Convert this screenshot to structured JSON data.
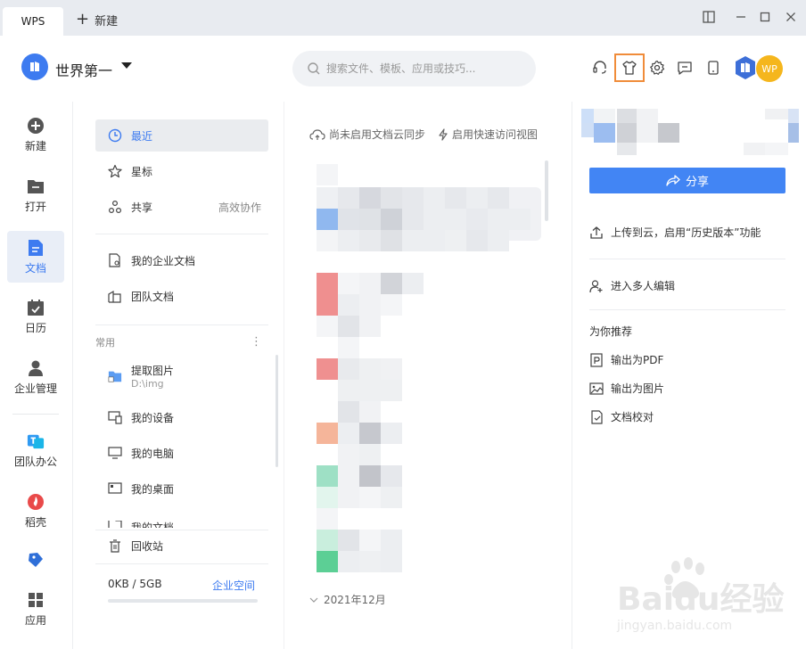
{
  "titlebar": {
    "tab_label": "WPS",
    "new_tab_label": "新建"
  },
  "header": {
    "workspace_name": "世界第一",
    "search_placeholder": "搜索文件、模板、应用或技巧...",
    "avatar_text": "WP"
  },
  "nav": {
    "items": [
      {
        "label": "新建",
        "icon": "plus-circle-icon"
      },
      {
        "label": "打开",
        "icon": "folder-icon"
      },
      {
        "label": "文档",
        "icon": "document-icon"
      },
      {
        "label": "日历",
        "icon": "calendar-icon"
      },
      {
        "label": "企业管理",
        "icon": "user-icon"
      },
      {
        "label": "团队办公",
        "icon": "team-icon"
      },
      {
        "label": "稻壳",
        "icon": "docer-icon"
      },
      {
        "label": "",
        "icon": "tag-icon"
      },
      {
        "label": "应用",
        "icon": "apps-icon"
      }
    ],
    "active": "文档"
  },
  "sidebar": {
    "recent": "最近",
    "starred": "星标",
    "shared": "共享",
    "shared_extra": "高效协作",
    "enterprise_docs": "我的企业文档",
    "team_docs": "团队文档",
    "section_common": "常用",
    "extract_images": "提取图片",
    "extract_images_path": "D:\\img",
    "my_devices": "我的设备",
    "my_computer": "我的电脑",
    "my_desktop": "我的桌面",
    "my_documents_partial": "我的文档",
    "recycle_bin": "回收站",
    "storage_used": "0KB / 5GB",
    "storage_link": "企业空间"
  },
  "main": {
    "cloud_sync": "尚未启用文档云同步",
    "quick_view": "启用快速访问视图",
    "date_group": "2021年12月"
  },
  "right": {
    "share_label": "分享",
    "upload_history": "上传到云，启用“历史版本”功能",
    "multi_edit": "进入多人编辑",
    "recommend_title": "为你推荐",
    "export_pdf": "输出为PDF",
    "export_image": "输出为图片",
    "proofread": "文档校对"
  },
  "watermark": {
    "text": "Baidu经验",
    "url_text": "jingyan.baidu.com"
  },
  "colors": {
    "accent": "#3d7bf0",
    "share_button": "#4285f4",
    "highlight_border": "#f08c3a",
    "avatar": "#f5b61d"
  }
}
